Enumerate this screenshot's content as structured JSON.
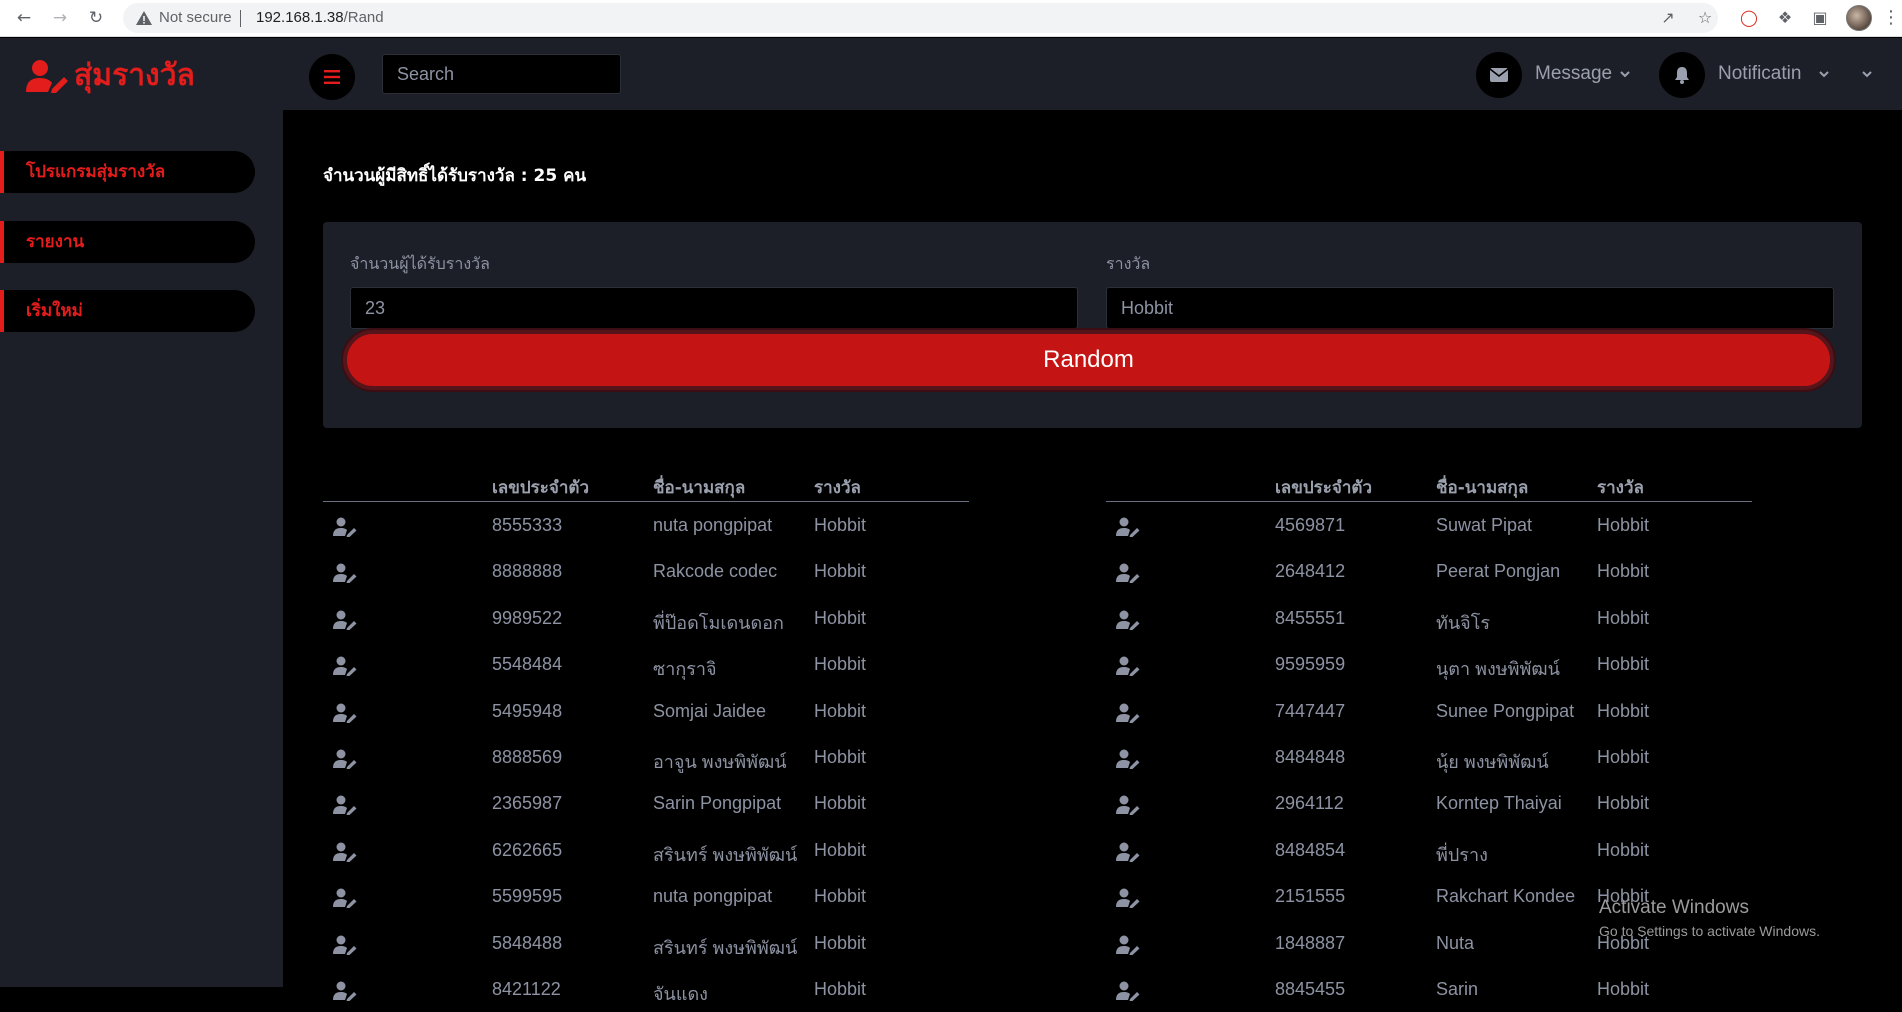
{
  "browser": {
    "not_secure": "Not secure",
    "url_host": "192.168.1.38",
    "url_path": "/Rand"
  },
  "header": {
    "brand": "สุ่มรางวัล",
    "search_placeholder": "Search",
    "message_label": "Message",
    "notification_label": "Notificatin"
  },
  "sidebar": {
    "items": [
      {
        "label": "โปรแกรมสุ่มรางวัล"
      },
      {
        "label": "รายงาน"
      },
      {
        "label": "เริ่มใหม่"
      }
    ]
  },
  "main": {
    "eligible_text": "จำนวนผู้มีสิทธิ์ได้รับรางวัล : 25 คน",
    "winners_label": "จำนวนผู้ได้รับรางวัล",
    "winners_value": "23",
    "prize_label": "รางวัล",
    "prize_value": "Hobbit",
    "random_button": "Random"
  },
  "table_headers": {
    "id": "เลขประจำตัว",
    "name": "ชื่อ-นามสกุล",
    "prize": "รางวัล"
  },
  "left_table": [
    {
      "id": "8555333",
      "name": "nuta pongpipat",
      "prize": "Hobbit"
    },
    {
      "id": "8888888",
      "name": "Rakcode codec",
      "prize": "Hobbit"
    },
    {
      "id": "9989522",
      "name": "พี่ป๊อดโมเดนดอก",
      "prize": "Hobbit"
    },
    {
      "id": "5548484",
      "name": "ซากุราจิ",
      "prize": "Hobbit"
    },
    {
      "id": "5495948",
      "name": "Somjai Jaidee",
      "prize": "Hobbit"
    },
    {
      "id": "8888569",
      "name": "อาจูน พงษพิพัฒน์",
      "prize": "Hobbit"
    },
    {
      "id": "2365987",
      "name": "Sarin Pongpipat",
      "prize": "Hobbit"
    },
    {
      "id": "6262665",
      "name": "สรินทร์ พงษพิพัฒน์",
      "prize": "Hobbit"
    },
    {
      "id": "5599595",
      "name": "nuta pongpipat",
      "prize": "Hobbit"
    },
    {
      "id": "5848488",
      "name": "สรินทร์ พงษพิพัฒน์",
      "prize": "Hobbit"
    },
    {
      "id": "8421122",
      "name": "จันแดง",
      "prize": "Hobbit"
    }
  ],
  "right_table": [
    {
      "id": "4569871",
      "name": "Suwat Pipat",
      "prize": "Hobbit"
    },
    {
      "id": "2648412",
      "name": "Peerat Pongjan",
      "prize": "Hobbit"
    },
    {
      "id": "8455551",
      "name": "ทันจิโร",
      "prize": "Hobbit"
    },
    {
      "id": "9595959",
      "name": "นุตา พงษพิพัฒน์",
      "prize": "Hobbit"
    },
    {
      "id": "7447447",
      "name": "Sunee Pongpipat",
      "prize": "Hobbit"
    },
    {
      "id": "8484848",
      "name": "นุ้ย พงษพิพัฒน์",
      "prize": "Hobbit"
    },
    {
      "id": "2964112",
      "name": "Korntep Thaiyai",
      "prize": "Hobbit"
    },
    {
      "id": "8484854",
      "name": "พี่ปราง",
      "prize": "Hobbit"
    },
    {
      "id": "2151555",
      "name": "Rakchart Kondee",
      "prize": "Hobbit"
    },
    {
      "id": "1848887",
      "name": "Nuta",
      "prize": "Hobbit"
    },
    {
      "id": "8845455",
      "name": "Sarin",
      "prize": "Hobbit"
    }
  ],
  "watermark": {
    "title": "Activate Windows",
    "subtitle": "Go to Settings to activate Windows."
  },
  "colors": {
    "accent": "#e31c1c",
    "button": "#c51414",
    "panel": "#1c1f28",
    "background": "#000000",
    "muted_text": "#8d93a3"
  },
  "icons": {
    "brand": "user-edit-icon",
    "menu": "bars-icon",
    "message": "envelope-icon",
    "notification": "bell-icon",
    "row_action": "user-edit-icon"
  }
}
